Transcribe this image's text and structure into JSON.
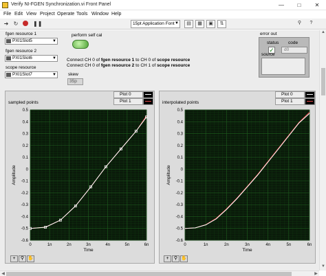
{
  "window": {
    "title": "Verify NI-FGEN Synchronization.vi Front Panel",
    "minimize_icon": "minimize-icon",
    "maximize_icon": "maximize-icon",
    "close_icon": "close-icon"
  },
  "menu": [
    "File",
    "Edit",
    "View",
    "Project",
    "Operate",
    "Tools",
    "Window",
    "Help"
  ],
  "toolbar": {
    "font": "15pt Application Font",
    "icons": [
      "run-arrow-icon",
      "run-continuously-icon",
      "abort-icon",
      "pause-icon",
      "align-icon",
      "distribute-icon",
      "resize-icon",
      "reorder-icon",
      "search-icon",
      "help-icon"
    ]
  },
  "controls": {
    "fgen_resource_1": {
      "label": "fgen resource 1",
      "value": "PXI1Slot5"
    },
    "fgen_resource_2": {
      "label": "fgen resource 2",
      "value": "PXI1Slot6"
    },
    "scope_resource": {
      "label": "scope resource",
      "value": "PXI1Slot7"
    },
    "perform_self_cal": {
      "label": "perform self cal"
    }
  },
  "instructions": {
    "line1_a": "Connect CH 0 of ",
    "line1_b": "fgen resource 1",
    "line1_c": " to CH 0 of ",
    "line1_d": "scope resource",
    "line2_a": "Connect CH 0 of ",
    "line2_b": "fgen resource 2",
    "line2_c": " to CH 1 of ",
    "line2_d": "scope resource"
  },
  "skew": {
    "label": "skew",
    "value": "35p"
  },
  "error_out": {
    "label": "error out",
    "status_label": "status",
    "code_label": "code",
    "code_value": "d0",
    "source_label": "source",
    "status_ok": true
  },
  "graphs": {
    "left": {
      "title": "sampled points",
      "legend": [
        "Plot 0",
        "Plot 1"
      ]
    },
    "right": {
      "title": "interpolated points",
      "legend": [
        "Plot 0",
        "Plot 1"
      ]
    }
  },
  "colors": {
    "plot_bg": "#0a1a0a",
    "grid": "#1e5c1e",
    "plot0": "#ffffff",
    "plot1": "#e84a4a"
  },
  "chart_data": [
    {
      "type": "line",
      "title": "sampled points",
      "xlabel": "Time",
      "ylabel": "Amplitude",
      "xlim": [
        0,
        6e-09
      ],
      "ylim": [
        -0.6,
        0.5
      ],
      "x_ticks": [
        "0",
        "1n",
        "2n",
        "3n",
        "4n",
        "5n",
        "6n"
      ],
      "y_ticks": [
        "-0.6",
        "-0.5",
        "-0.4",
        "-0.3",
        "-0.2",
        "-0.1",
        "0",
        "0.1",
        "0.2",
        "0.3",
        "0.4",
        "0.5"
      ],
      "grid": true,
      "series": [
        {
          "name": "Plot 0",
          "x": [
            0,
            7.8e-10,
            1.56e-09,
            2.34e-09,
            3.12e-09,
            3.9e-09,
            4.68e-09,
            5.46e-09,
            6e-09
          ],
          "y": [
            -0.5,
            -0.49,
            -0.43,
            -0.31,
            -0.15,
            0.02,
            0.17,
            0.32,
            0.44
          ]
        },
        {
          "name": "Plot 1",
          "x": [
            0,
            7.8e-10,
            1.56e-09,
            2.34e-09,
            3.12e-09,
            3.9e-09,
            4.68e-09,
            5.46e-09,
            6e-09
          ],
          "y": [
            -0.5,
            -0.49,
            -0.43,
            -0.31,
            -0.15,
            0.02,
            0.17,
            0.32,
            0.45
          ]
        }
      ]
    },
    {
      "type": "line",
      "title": "interpolated points",
      "xlabel": "Time",
      "ylabel": "Amplitude",
      "xlim": [
        0,
        6e-09
      ],
      "ylim": [
        -0.6,
        0.5
      ],
      "x_ticks": [
        "0",
        "1n",
        "2n",
        "3n",
        "4n",
        "5n",
        "6n"
      ],
      "y_ticks": [
        "-0.6",
        "-0.5",
        "-0.4",
        "-0.3",
        "-0.2",
        "-0.1",
        "0",
        "0.1",
        "0.2",
        "0.3",
        "0.4",
        "0.5"
      ],
      "grid": true,
      "series": [
        {
          "name": "Plot 0",
          "x": [
            0,
            5e-10,
            1e-09,
            1.5e-09,
            2e-09,
            2.5e-09,
            3e-09,
            3.5e-09,
            4e-09,
            4.5e-09,
            5e-09,
            5.5e-09,
            6e-09
          ],
          "y": [
            -0.5,
            -0.495,
            -0.47,
            -0.42,
            -0.34,
            -0.25,
            -0.15,
            -0.05,
            0.06,
            0.17,
            0.28,
            0.39,
            0.47
          ]
        },
        {
          "name": "Plot 1",
          "x": [
            0,
            5e-10,
            1e-09,
            1.5e-09,
            2e-09,
            2.5e-09,
            3e-09,
            3.5e-09,
            4e-09,
            4.5e-09,
            5e-09,
            5.5e-09,
            6e-09
          ],
          "y": [
            -0.5,
            -0.495,
            -0.468,
            -0.415,
            -0.335,
            -0.245,
            -0.145,
            -0.045,
            0.065,
            0.175,
            0.285,
            0.395,
            0.48
          ]
        }
      ]
    }
  ]
}
